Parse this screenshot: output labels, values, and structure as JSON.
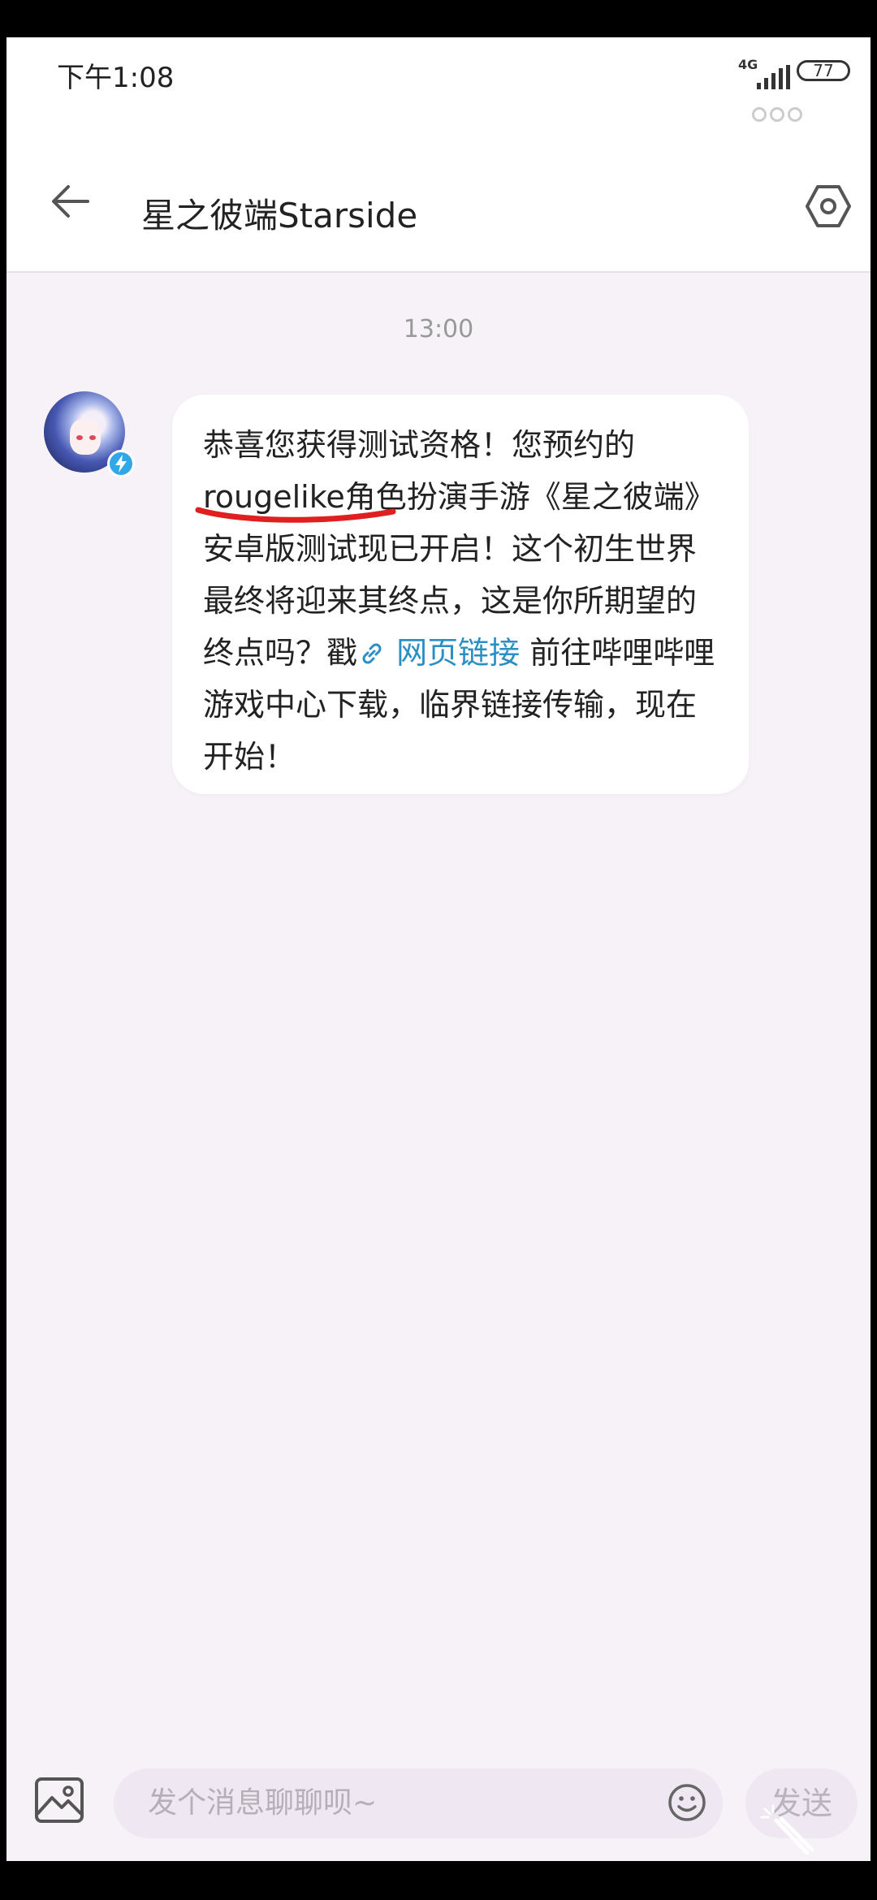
{
  "status_bar": {
    "time": "下午1:08",
    "network": "4G",
    "battery": "77"
  },
  "header": {
    "title": "星之彼端Starside",
    "back_icon": "arrow-left-icon",
    "settings_icon": "hexagon-settings-icon"
  },
  "chat": {
    "timestamp": "13:00",
    "message": {
      "text_before_link": "恭喜您获得测试资格！您预约的rougelike角色扮演手游《星之彼端》安卓版测试现已开启！这个初生世界最终将迎来其终点，这是你所期望的终点吗？戳",
      "link_text": "网页链接",
      "text_after_link": " 前往哔哩哔哩游戏中心下载，临界链接传输，现在开始！"
    }
  },
  "input_bar": {
    "placeholder": "发个消息聊聊呗~",
    "send_label": "发送",
    "image_icon": "image-icon",
    "emoji_icon": "emoji-icon"
  },
  "colors": {
    "background": "#f7f1f8",
    "link": "#2c8fc4",
    "underline_annotation": "#e02020"
  }
}
